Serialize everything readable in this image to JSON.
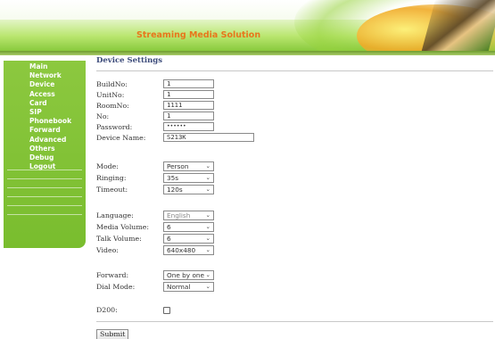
{
  "header": {
    "title": "Streaming Media Solution"
  },
  "sidebar": {
    "items": [
      {
        "label": "Main"
      },
      {
        "label": "Network"
      },
      {
        "label": "Device"
      },
      {
        "label": "Access"
      },
      {
        "label": "Card"
      },
      {
        "label": "SIP"
      },
      {
        "label": "Phonebook"
      },
      {
        "label": "Forward"
      },
      {
        "label": "Advanced"
      },
      {
        "label": "Others"
      },
      {
        "label": "Debug"
      },
      {
        "label": "Logout"
      }
    ]
  },
  "main": {
    "title": "Device Settings",
    "fields": {
      "build_no": {
        "label": "BuildNo:",
        "value": "1"
      },
      "unit_no": {
        "label": "UnitNo:",
        "value": "1"
      },
      "room_no": {
        "label": "RoomNo:",
        "value": "1111"
      },
      "no": {
        "label": "No:",
        "value": "1"
      },
      "password": {
        "label": "Password:",
        "value": "••••••"
      },
      "device_name": {
        "label": "Device Name:",
        "value": "S213K"
      },
      "mode": {
        "label": "Mode:",
        "value": "Person"
      },
      "ringing": {
        "label": "Ringing:",
        "value": "35s"
      },
      "timeout": {
        "label": "Timeout:",
        "value": "120s"
      },
      "language": {
        "label": "Language:",
        "value": "English"
      },
      "media_volume": {
        "label": "Media Volume:",
        "value": "6"
      },
      "talk_volume": {
        "label": "Talk Volume:",
        "value": "6"
      },
      "video": {
        "label": "Video:",
        "value": "640x480"
      },
      "forward": {
        "label": "Forward:",
        "value": "One by one"
      },
      "dial_mode": {
        "label": "Dial Mode:",
        "value": "Normal"
      },
      "d200": {
        "label": "D200:",
        "checked": false
      }
    },
    "submit_label": "Submit"
  },
  "icons": {
    "dropdown": "chevron-down-icon"
  },
  "colors": {
    "sidebar_bg": "#80c234",
    "header_title": "#e8761c",
    "page_title": "#3b4a7a"
  }
}
